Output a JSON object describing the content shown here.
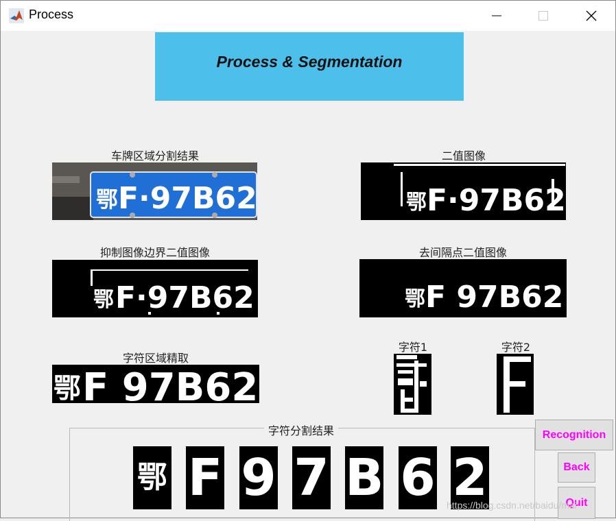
{
  "window": {
    "title": "Process"
  },
  "banner": {
    "title": "Process & Segmentation"
  },
  "images": {
    "plate_region": {
      "caption": "车牌区域分割结果",
      "plate_text": "F·97B62"
    },
    "binary": {
      "caption": "二值图像",
      "plate_text": "F·97B62"
    },
    "border_suppressed": {
      "caption": "抑制图像边界二值图像",
      "plate_text": "F·97B62"
    },
    "dot_removed": {
      "caption": "去间隔点二值图像",
      "plate_text": "F 97B62"
    },
    "char_region": {
      "caption": "字符区域精取",
      "plate_text": "F 97B62"
    },
    "char1": {
      "caption": "字符1"
    },
    "char2": {
      "caption": "字符2",
      "glyph": "F"
    }
  },
  "segmentation": {
    "title": "字符分割结果",
    "characters": [
      "鄂",
      "F",
      "9",
      "7",
      "B",
      "6",
      "2"
    ]
  },
  "buttons": {
    "recognition": "Recognition",
    "back": "Back",
    "quit": "Quit"
  },
  "watermark": "https://blog.csdn.net/baidu/mai",
  "colors": {
    "banner": "#4dbfeb",
    "button_text": "#ff00ff",
    "plate_blue": "#1f6fd6"
  }
}
